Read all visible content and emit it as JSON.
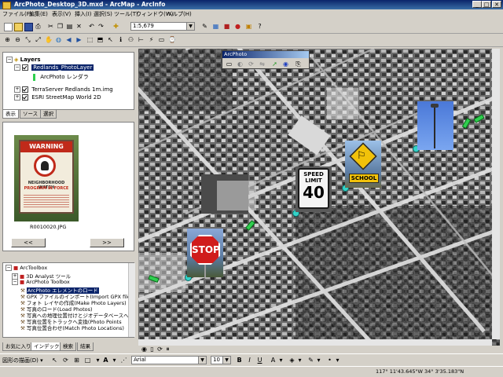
{
  "window": {
    "title": "ArcPhoto_Desktop_3D.mxd - ArcMap - ArcInfo"
  },
  "menu": [
    "ファイル(F)",
    "編集(E)",
    "表示(V)",
    "挿入(I)",
    "選択(S)",
    "ツール(T)",
    "ウィンドウ(W)",
    "ヘルプ(H)"
  ],
  "toolbar": {
    "scale": "1:5,679"
  },
  "toc": {
    "root": "Layers",
    "items": [
      {
        "label": "Redlands_PhotoLayer",
        "selected": true
      },
      {
        "label": "ArcPhoto レンダラ"
      },
      {
        "label": "TerraServer Redlands 1m.img"
      },
      {
        "label": "ESRI StreetMap World 2D"
      }
    ],
    "tabs": [
      "表示",
      "ソース",
      "選択"
    ]
  },
  "photo_panel": {
    "sign_title": "WARNING",
    "sign_line1": "NEIGHBORHOOD WATCH",
    "sign_line2": "PROGRAM IN FORCE",
    "caption": "R0010020.JPG",
    "prev": "<<",
    "next": ">>"
  },
  "toolbox": {
    "items": [
      "ArcToolbox",
      "3D Analyst ツール",
      "ArcPhoto Toolbox",
      "ArcPhoto エレメントのロード",
      "GPX ファイルのインポート(Import GPX file)",
      "フォト レイヤの作成(Make Photo Layers)",
      "写真のロード(Load Photos)",
      "写真への地理位置付けとジオデータベースへの",
      "写真位置をトラックへ変換(Photo Points",
      "写真位置合わせ(Match Photo Locations)"
    ],
    "tabs": [
      "お気に入り",
      "インデックス",
      "検索",
      "結果"
    ]
  },
  "arcphoto_toolbar": {
    "title": "ArcPhoto"
  },
  "map_signs": {
    "speed_line1": "SPEED",
    "speed_line2": "LIMIT",
    "speed_value": "40",
    "school": "SCHOOL",
    "stop": "STOP"
  },
  "draw_toolbar": {
    "label": "図形の描画(D) ▾",
    "font": "Arial",
    "size": "10"
  },
  "status": {
    "coords": "117° 11'43.645\"W  34° 3'35.183\"N"
  }
}
